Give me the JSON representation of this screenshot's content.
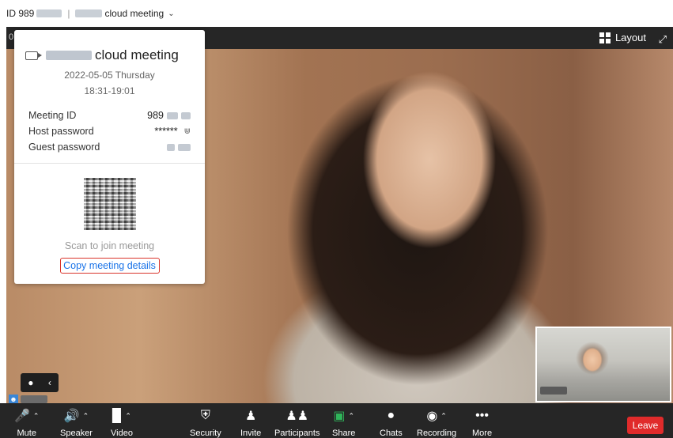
{
  "titlebar": {
    "id_prefix": "ID 989",
    "meeting_suffix": "cloud meeting"
  },
  "video": {
    "corner_digit": "0",
    "layout_label": "Layout"
  },
  "info": {
    "title": "cloud meeting",
    "date": "2022-05-05 Thursday",
    "time": "18:31-19:01",
    "meeting_id_label": "Meeting ID",
    "meeting_id_prefix": "989",
    "host_password_label": "Host password",
    "host_password_value": "******",
    "guest_password_label": "Guest password",
    "scan_text": "Scan to join meeting",
    "copy_label": "Copy meeting details"
  },
  "toolbar": {
    "mute": "Mute",
    "speaker": "Speaker",
    "video": "Video",
    "security": "Security",
    "invite": "Invite",
    "participants": "Participants",
    "share": "Share",
    "chats": "Chats",
    "recording": "Recording",
    "more": "More",
    "leave": "Leave"
  },
  "colors": {
    "leave": "#e02b2b",
    "link": "#1a73e8",
    "highlight_border": "#d9342b",
    "share_icon": "#2fb55a",
    "toolbar_bg": "#262626"
  },
  "icons": [
    "chevron-down-icon",
    "grid-icon",
    "expand-icon",
    "camera-icon",
    "eye-closed-icon",
    "qr-code",
    "chat-bubble-icon",
    "chevron-left-icon",
    "microphone-muted-icon",
    "speaker-icon",
    "video-off-icon",
    "shield-icon",
    "add-person-icon",
    "participants-icon",
    "share-screen-icon",
    "chat-icon",
    "record-icon",
    "more-dots-icon"
  ]
}
